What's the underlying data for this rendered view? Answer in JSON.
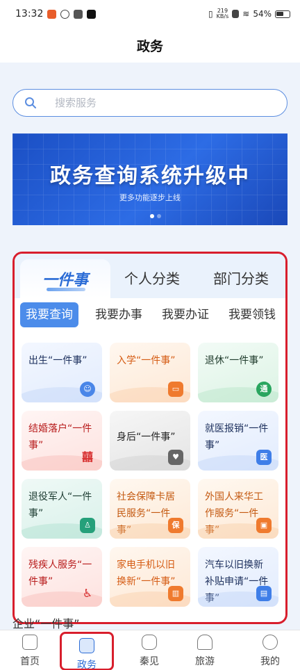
{
  "status_bar": {
    "time": "13:32",
    "net_speed_value": "219",
    "net_speed_unit": "KB/s",
    "battery": "54%"
  },
  "header": {
    "title": "政务"
  },
  "search": {
    "placeholder": "搜索服务"
  },
  "banner": {
    "title": "政务查询系统升级中",
    "subtitle": "更多功能逐步上线"
  },
  "tabs": {
    "main": "一件事",
    "personal": "个人分类",
    "department": "部门分类"
  },
  "sub_tabs": [
    "我要查询",
    "我要办事",
    "我要办证",
    "我要领钱"
  ],
  "tiles": [
    {
      "label": "出生“一件事”",
      "icon": "baby-icon",
      "color": "blue"
    },
    {
      "label": "入学“一件事”",
      "icon": "backpack-icon",
      "color": "orange"
    },
    {
      "label": "退休“一件事”",
      "icon": "medal-icon",
      "color": "green"
    },
    {
      "label": "结婚落户“一件事”",
      "icon": "double-happiness-icon",
      "color": "red"
    },
    {
      "label": "身后“一件事”",
      "icon": "broken-heart-icon",
      "color": "gray"
    },
    {
      "label": "就医报销“一件事”",
      "icon": "medical-shield-icon",
      "color": "blue"
    },
    {
      "label": "退役军人“一件事”",
      "icon": "soldier-icon",
      "color": "teal"
    },
    {
      "label": "社会保障卡居民服务“一件事”",
      "icon": "insurance-icon",
      "color": "peach"
    },
    {
      "label": "外国人来华工作服务“一件事”",
      "icon": "id-card-icon",
      "color": "peach"
    },
    {
      "label": "残疾人服务“一件事”",
      "icon": "wheelchair-icon",
      "color": "red"
    },
    {
      "label": "家电手机以旧换新“一件事”",
      "icon": "fridge-icon",
      "color": "orange"
    },
    {
      "label": "汽车以旧换新补贴申请“一件事”",
      "icon": "car-icon",
      "color": "blue"
    }
  ],
  "peek_text": "企业“一件事”",
  "bottom_nav": [
    "首页",
    "政务",
    "秦见",
    "旅游",
    "我的"
  ]
}
